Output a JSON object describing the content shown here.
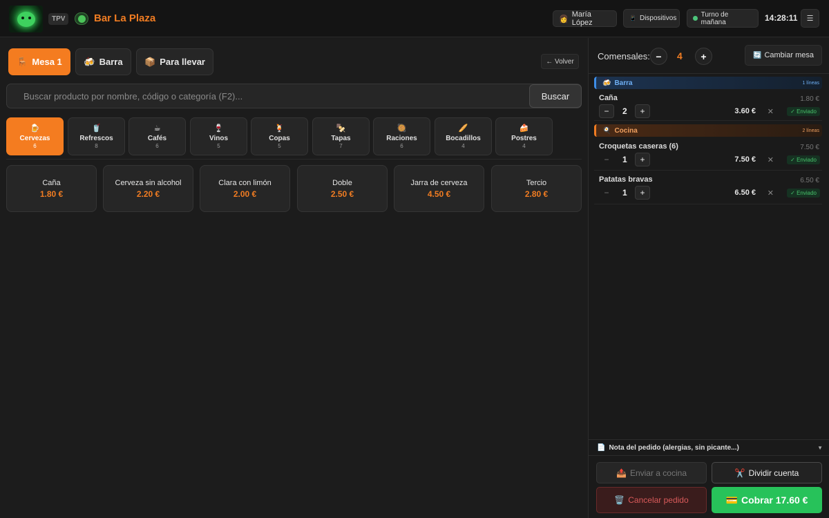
{
  "header": {
    "badge": "TPV",
    "bar_name": "Bar La Plaza",
    "user": "María López",
    "devices": "Dispositivos",
    "shift": "Turno de mañana",
    "clock": "14:28:11",
    "menu": "☰"
  },
  "modes": [
    {
      "icon": "🪑",
      "label": "Mesa 1",
      "active": true
    },
    {
      "icon": "🍻",
      "label": "Barra",
      "active": false
    },
    {
      "icon": "📦",
      "label": "Para llevar",
      "active": false
    }
  ],
  "back_label": "← Volver",
  "search": {
    "placeholder": "Buscar producto por nombre, código o categoría (F2)...",
    "button": "Buscar"
  },
  "categories": [
    {
      "icon": "🍺",
      "name": "Cervezas",
      "count": "6"
    },
    {
      "icon": "🥤",
      "name": "Refrescos",
      "count": "8"
    },
    {
      "icon": "☕",
      "name": "Cafés",
      "count": "6"
    },
    {
      "icon": "🍷",
      "name": "Vinos",
      "count": "5"
    },
    {
      "icon": "🍹",
      "name": "Copas",
      "count": "5"
    },
    {
      "icon": "🍢",
      "name": "Tapas",
      "count": "7"
    },
    {
      "icon": "🥘",
      "name": "Raciones",
      "count": "6"
    },
    {
      "icon": "🥖",
      "name": "Bocadillos",
      "count": "4"
    },
    {
      "icon": "🍰",
      "name": "Postres",
      "count": "4"
    }
  ],
  "products": [
    {
      "name": "Caña",
      "price": "1.80 €"
    },
    {
      "name": "Cerveza sin alcohol",
      "price": "2.20 €"
    },
    {
      "name": "Clara con limón",
      "price": "2.00 €"
    },
    {
      "name": "Doble",
      "price": "2.50 €"
    },
    {
      "name": "Jarra de cerveza",
      "price": "4.50 €"
    },
    {
      "name": "Tercio",
      "price": "2.80 €"
    }
  ],
  "order": {
    "diners_label": "Comensales:",
    "diners": "4",
    "change_table": "Cambiar mesa",
    "change_table_icon": "🔄",
    "sections": [
      {
        "icon": "🍻",
        "name": "Barra",
        "lines": "1 líneas",
        "items": [
          {
            "name": "Caña",
            "unit": "1.80 €",
            "qty": "2",
            "total": "3.60 €",
            "status": "✓ Enviado"
          }
        ]
      },
      {
        "icon": "🍳",
        "name": "Cocina",
        "lines": "2 líneas",
        "items": [
          {
            "name": "Croquetas caseras (6)",
            "unit": "7.50 €",
            "qty": "1",
            "total": "7.50 €",
            "status": "✓ Enviado"
          },
          {
            "name": "Patatas bravas",
            "unit": "6.50 €",
            "qty": "1",
            "total": "6.50 €",
            "status": "✓ Enviado"
          }
        ]
      }
    ],
    "note_icon": "📄",
    "note": "Nota del pedido (alergias, sin picante...)",
    "send_kitchen": "Enviar a cocina",
    "split": "Dividir cuenta",
    "cancel": "Cancelar pedido",
    "charge": "Cobrar 17.60 €",
    "icons": {
      "send": "📤",
      "split": "✂️",
      "cancel": "🗑️",
      "charge": "💳"
    }
  },
  "colors": {
    "accent": "#f47c20",
    "success": "#27c25a",
    "danger": "#d95a5a",
    "info": "#3d8ee8"
  }
}
